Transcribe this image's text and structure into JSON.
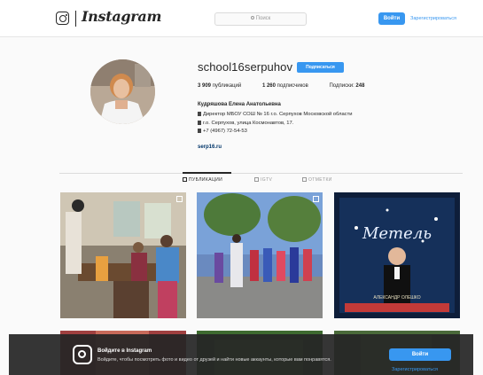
{
  "header": {
    "logo_text": "Instagram",
    "search_placeholder": "Поиск",
    "login_label": "Войти",
    "register_label": "Зарегистрироваться"
  },
  "profile": {
    "username": "school16serpuhov",
    "follow_label": "Подписаться",
    "posts_count": "3 909",
    "posts_label": "публикаций",
    "followers_count": "1 260",
    "followers_label": "подписчиков",
    "following_label": "Подписки:",
    "following_count": "248",
    "full_name": "Кудряшова Елена Анатольевна",
    "bio_lines": [
      "Директор МБОУ СОШ № 16 г.о. Серпухов Московской области",
      "г.о. Серпухов, улица Космонавтов, 17.",
      "+7 (4967) 72-54-53"
    ],
    "website": "serp16.ru"
  },
  "tabs": [
    {
      "label": "ПУБЛИКАЦИИ",
      "icon": "grid-icon",
      "active": true
    },
    {
      "label": "IGTV",
      "icon": "tv-icon",
      "active": false
    },
    {
      "label": "ОТМЕТКИ",
      "icon": "tag-icon",
      "active": false
    }
  ],
  "posts": [
    {
      "description_icon": "carousel-icon"
    },
    {
      "description_icon": "carousel-icon"
    },
    {
      "poster_title": "Метель",
      "poster_name": "АЛЕКСАНДР ОЛЕШКО"
    }
  ],
  "banner": {
    "title": "Войдите в Instagram",
    "text": "Войдите, чтобы посмотреть фото и видео от друзей и найти новые аккаунты, которые вам понравятся.",
    "login_label": "Войти",
    "register_label": "Зарегистрироваться"
  },
  "colors": {
    "accent": "#3897f0",
    "banner_bg": "#262626",
    "page_bg": "#fafafa"
  }
}
